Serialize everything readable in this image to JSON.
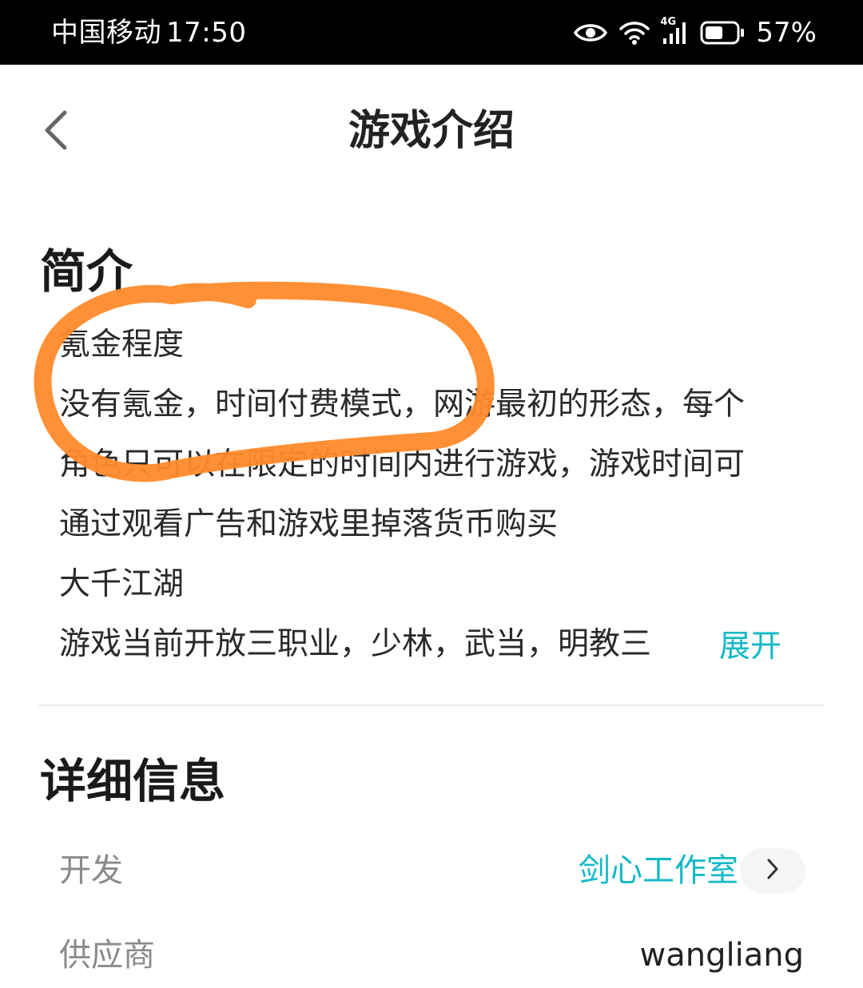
{
  "status_bar": {
    "carrier": "中国移动",
    "time": "17:50",
    "network": "4G",
    "battery_percent": "57%",
    "icons": [
      "eye-icon",
      "wifi-icon",
      "cellular-signal-icon",
      "battery-icon"
    ]
  },
  "header": {
    "title": "游戏介绍",
    "back_icon": "chevron-left-icon"
  },
  "intro": {
    "heading": "简介",
    "lines": [
      "氪金程度",
      "没有氪金，时间付费模式，网游最初的形态，每个",
      "角色只可以在限定的时间内进行游戏，游戏时间可",
      "通过观看广告和游戏里掉落货币购买",
      "大千江湖",
      "游戏当前开放三职业，少林，武当，明教三"
    ],
    "expand_label": "展开"
  },
  "details": {
    "heading": "详细信息",
    "developer_label": "开发",
    "developer_value": "剑心工作室",
    "developer_chevron_icon": "chevron-right-icon",
    "supplier_label": "供应商",
    "supplier_value": "wangliang"
  },
  "colors": {
    "accent": "#14b9c6",
    "annotation": "#ff8a2a",
    "status_bar_bg": "#000000"
  }
}
